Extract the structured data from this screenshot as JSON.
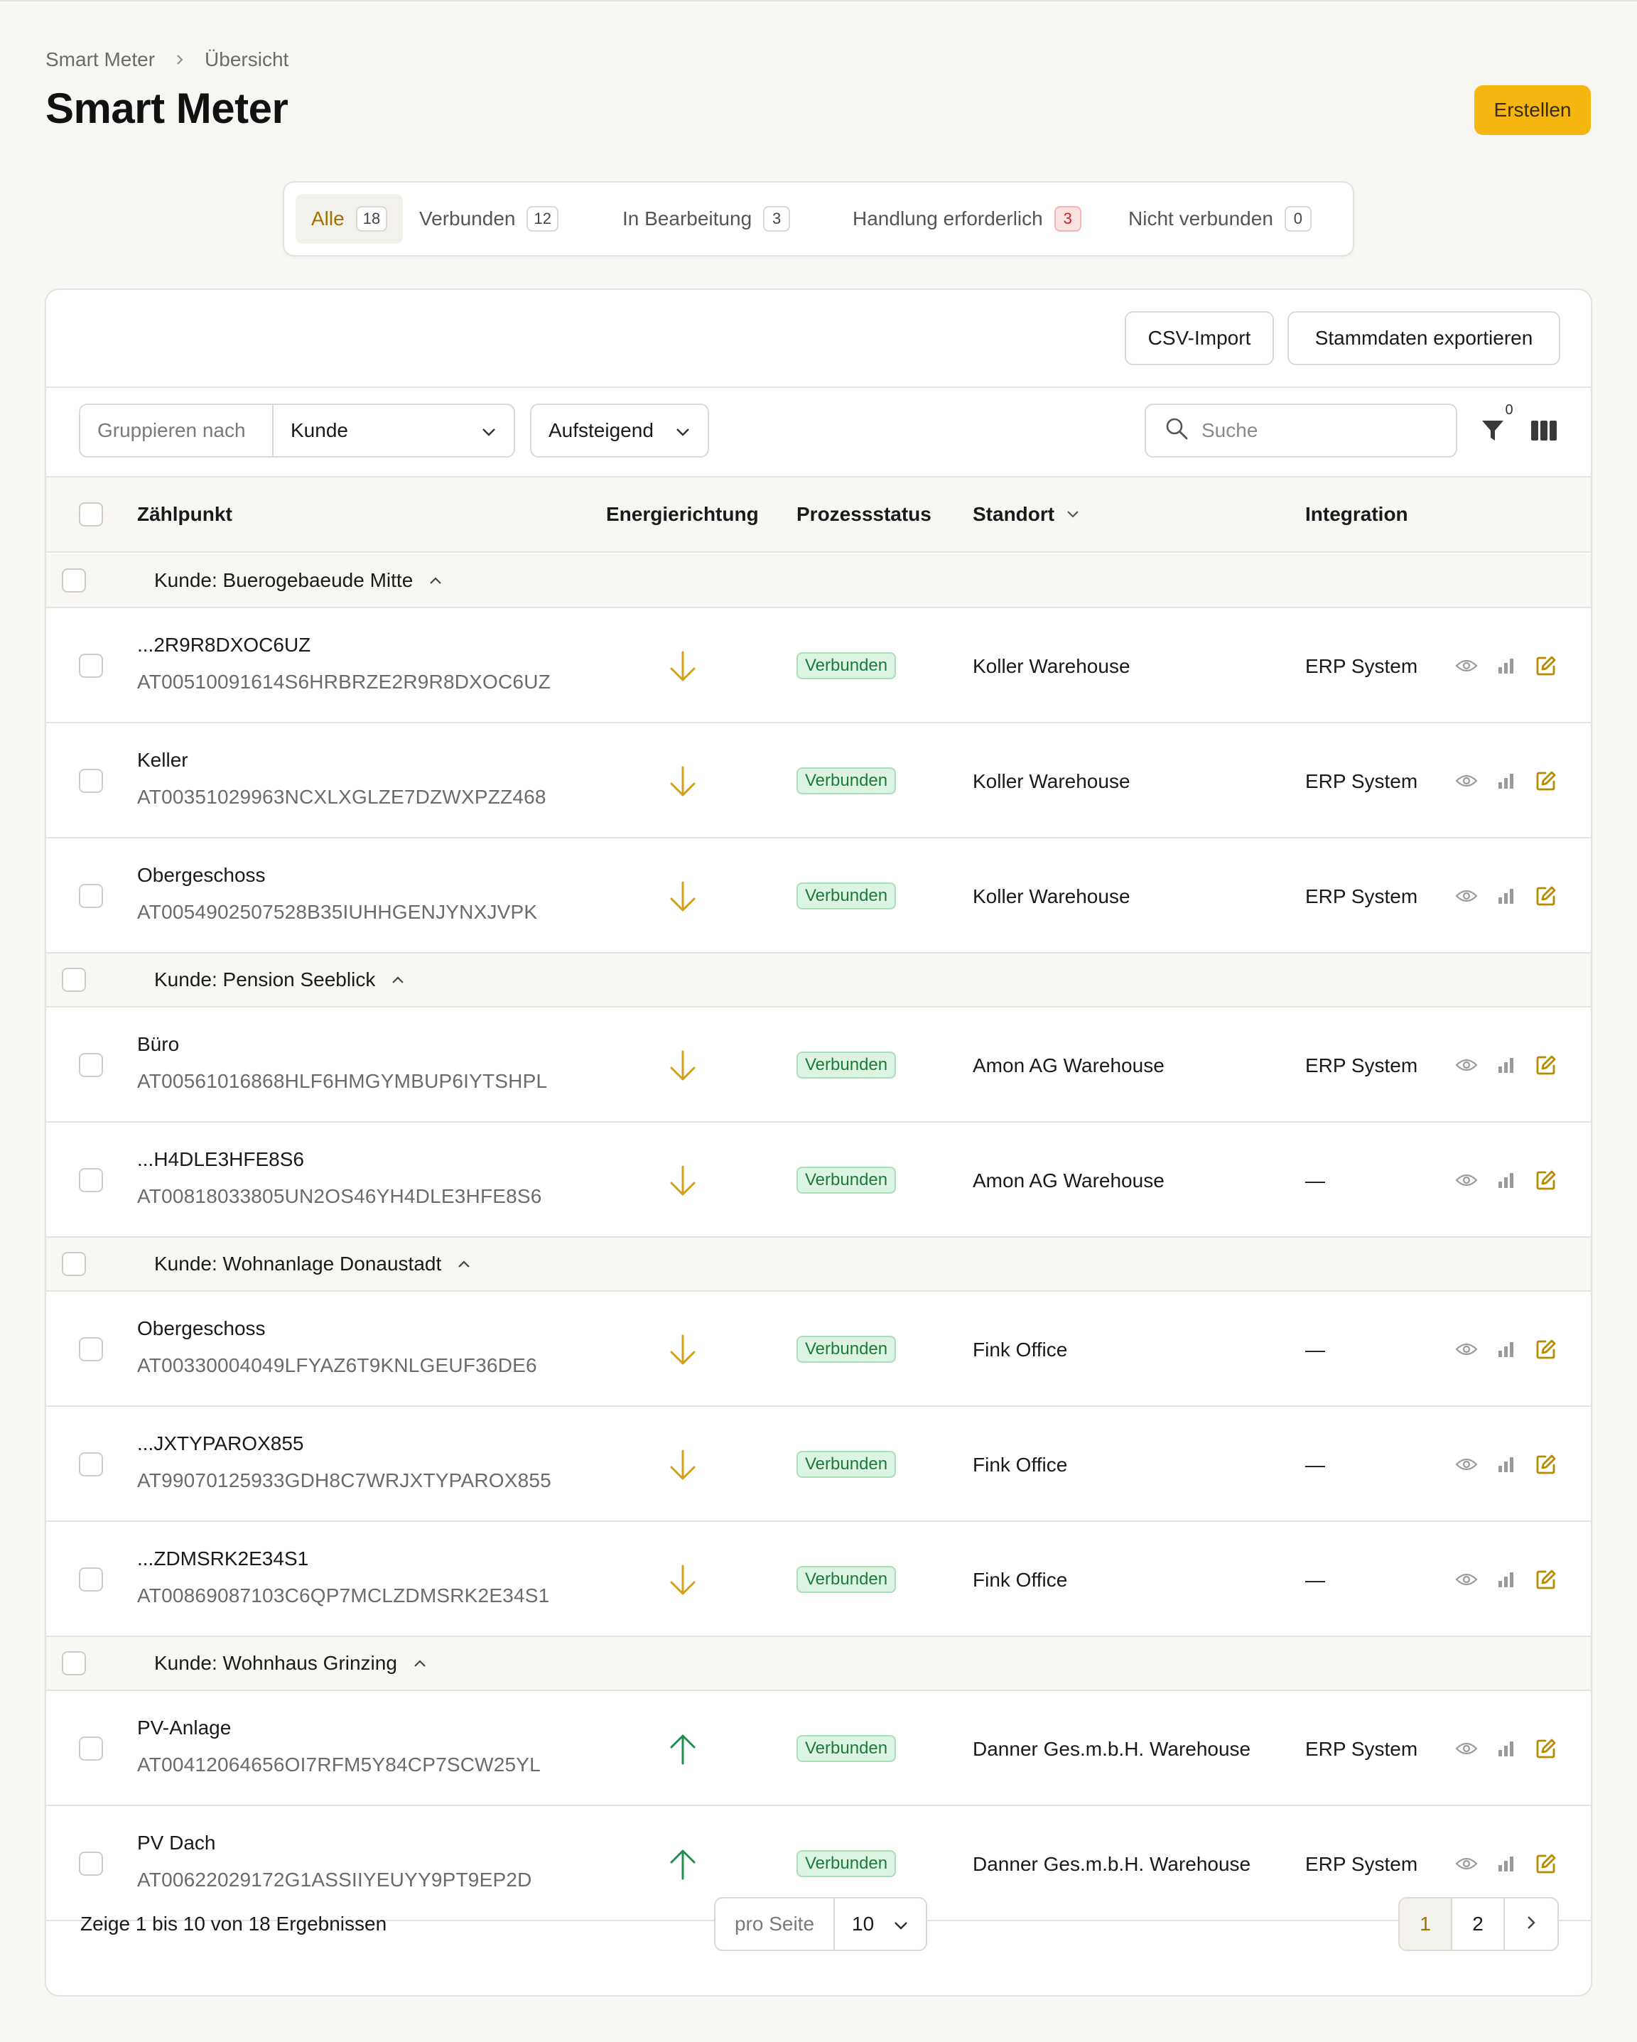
{
  "breadcrumb": {
    "root": "Smart Meter",
    "current": "Übersicht"
  },
  "header": {
    "title": "Smart Meter",
    "create_label": "Erstellen"
  },
  "tabs": [
    {
      "label": "Alle",
      "count": "18"
    },
    {
      "label": "Verbunden",
      "count": "12"
    },
    {
      "label": "In Bearbeitung",
      "count": "3"
    },
    {
      "label": "Handlung erforderlich",
      "count": "3"
    },
    {
      "label": "Nicht verbunden",
      "count": "0"
    }
  ],
  "toolbar": {
    "csv_import": "CSV-Import",
    "export": "Stammdaten exportieren"
  },
  "controls": {
    "group_label": "Gruppieren nach",
    "group_value": "Kunde",
    "sort_value": "Aufsteigend",
    "search_placeholder": "Suche",
    "filter_count": "0"
  },
  "columns": {
    "zaehlpunkt": "Zählpunkt",
    "energy": "Energierichtung",
    "status": "Prozessstatus",
    "location": "Standort",
    "integration": "Integration"
  },
  "groups": [
    {
      "title": "Kunde: Buerogebaeude Mitte",
      "rows": [
        {
          "name": "...2R9R8DXOC6UZ",
          "id": "AT00510091614S6HRBRZE2R9R8DXOC6UZ",
          "direction": "down",
          "status": "Verbunden",
          "location": "Koller Warehouse",
          "integration": "ERP System"
        },
        {
          "name": "Keller",
          "id": "AT00351029963NCXLXGLZE7DZWXPZZ468",
          "direction": "down",
          "status": "Verbunden",
          "location": "Koller Warehouse",
          "integration": "ERP System"
        },
        {
          "name": "Obergeschoss",
          "id": "AT0054902507528B35IUHHGENJYNXJVPK",
          "direction": "down",
          "status": "Verbunden",
          "location": "Koller Warehouse",
          "integration": "ERP System"
        }
      ]
    },
    {
      "title": "Kunde: Pension Seeblick",
      "rows": [
        {
          "name": "Büro",
          "id": "AT00561016868HLF6HMGYMBUP6IYTSHPL",
          "direction": "down",
          "status": "Verbunden",
          "location": "Amon AG Warehouse",
          "integration": "ERP System"
        },
        {
          "name": "...H4DLE3HFE8S6",
          "id": "AT00818033805UN2OS46YH4DLE3HFE8S6",
          "direction": "down",
          "status": "Verbunden",
          "location": "Amon AG Warehouse",
          "integration": "—"
        }
      ]
    },
    {
      "title": "Kunde: Wohnanlage Donaustadt",
      "rows": [
        {
          "name": "Obergeschoss",
          "id": "AT00330004049LFYAZ6T9KNLGEUF36DE6",
          "direction": "down",
          "status": "Verbunden",
          "location": "Fink Office",
          "integration": "—"
        },
        {
          "name": "...JXTYPAROX855",
          "id": "AT99070125933GDH8C7WRJXTYPAROX855",
          "direction": "down",
          "status": "Verbunden",
          "location": "Fink Office",
          "integration": "—"
        },
        {
          "name": "...ZDMSRK2E34S1",
          "id": "AT00869087103C6QP7MCLZDMSRK2E34S1",
          "direction": "down",
          "status": "Verbunden",
          "location": "Fink Office",
          "integration": "—"
        }
      ]
    },
    {
      "title": "Kunde: Wohnhaus Grinzing",
      "rows": [
        {
          "name": "PV-Anlage",
          "id": "AT00412064656OI7RFM5Y84CP7SCW25YL",
          "direction": "up",
          "status": "Verbunden",
          "location": "Danner Ges.m.b.H. Warehouse",
          "integration": "ERP System"
        },
        {
          "name": "PV Dach",
          "id": "AT00622029172G1ASSIIYEUYY9PT9EP2D",
          "direction": "up",
          "status": "Verbunden",
          "location": "Danner Ges.m.b.H. Warehouse",
          "integration": "ERP System"
        }
      ]
    }
  ],
  "footer": {
    "summary": "Zeige 1 bis 10 von 18 Ergebnissen",
    "per_page_label": "pro Seite",
    "per_page_value": "10",
    "pages": [
      "1",
      "2"
    ]
  },
  "colors": {
    "accent": "#f5b70f",
    "arrow_down": "#d4a017",
    "arrow_up": "#1f8f4e",
    "status_bg": "#dcf5e3",
    "status_text": "#1e7a3a"
  },
  "icons": {
    "row_actions": [
      "eye-icon",
      "bar-chart-icon",
      "edit-icon"
    ],
    "direction_down": "arrow-down-icon",
    "direction_up": "arrow-up-icon"
  }
}
